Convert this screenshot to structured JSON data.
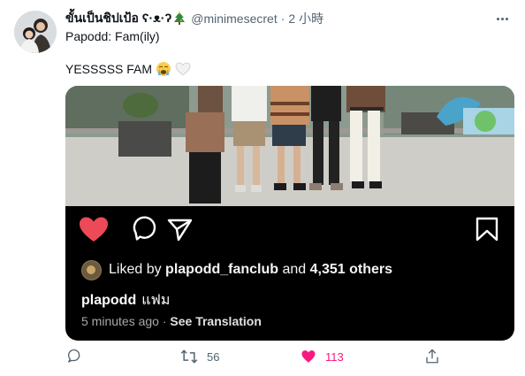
{
  "tweet": {
    "author_name": "ขั้นเป็นชิปเป้อ ʕ·ᴥ·ʔ",
    "author_handle": "@minimesecret",
    "separator": "·",
    "time": "2 小時",
    "quoted_line": "Papodd: Fam(ily)",
    "text": "YESSSSS FAM",
    "emojis": [
      "loudly-crying-face-icon",
      "white-heart-icon"
    ]
  },
  "instagram": {
    "liked_by_prefix": "Liked by",
    "liked_by_user": "plapodd_fanclub",
    "liked_by_and": "and",
    "liked_by_count": "4,351 others",
    "caption_user": "plapodd",
    "caption_text": "แฟม",
    "time_ago": "5 minutes ago",
    "see_translation": "See Translation"
  },
  "actions": {
    "retweet_count": "56",
    "like_count": "113"
  },
  "colors": {
    "like_red": "#f91880",
    "ig_heart_red": "#ed4956",
    "secondary_text": "#536471"
  }
}
